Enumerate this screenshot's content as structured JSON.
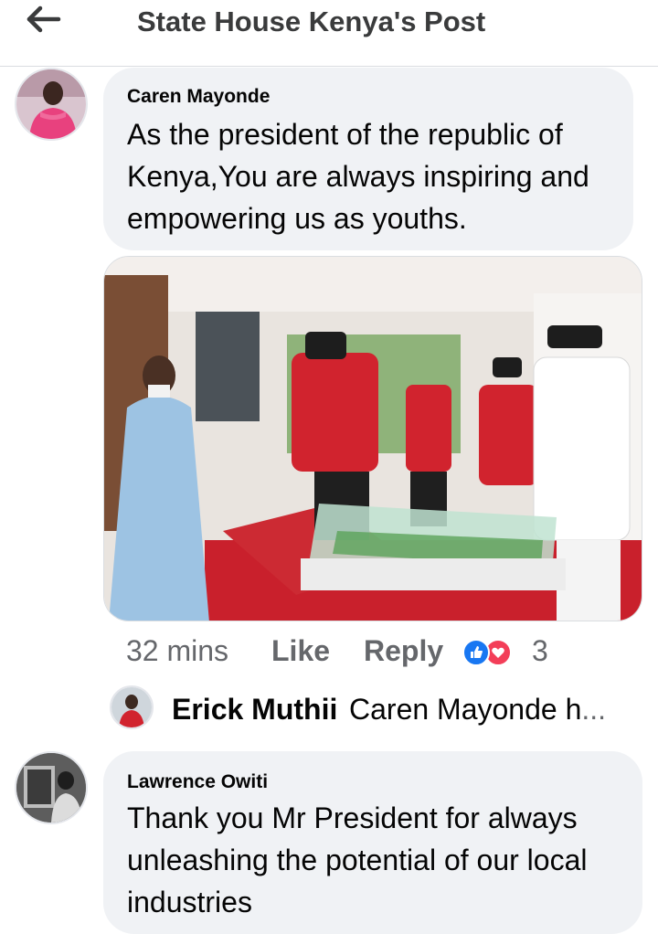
{
  "header": {
    "title": "State House Kenya's Post",
    "back_icon": "arrow-left-icon"
  },
  "comments": [
    {
      "author": "Caren Mayonde",
      "lines": [
        "As the president of the republic of",
        "Kenya,You are always inspiring and",
        "empowering us as youths."
      ],
      "time": "32 mins",
      "like_label": "Like",
      "reply_label": "Reply",
      "reaction_count": "3",
      "reactions": [
        "like-icon",
        "love-icon"
      ]
    },
    {
      "author": "Lawrence Owiti",
      "lines": [
        "Thank you Mr President for always",
        "unleashing the potential of our local",
        "industries"
      ]
    }
  ],
  "reply_preview": {
    "author": "Erick Muthii",
    "text": "Caren Mayonde h",
    "ellipsis": "..."
  },
  "colors": {
    "like_blue": "#1877f2",
    "love_red": "#f33e58",
    "bubble": "#f0f2f5",
    "muted": "#65676b"
  }
}
